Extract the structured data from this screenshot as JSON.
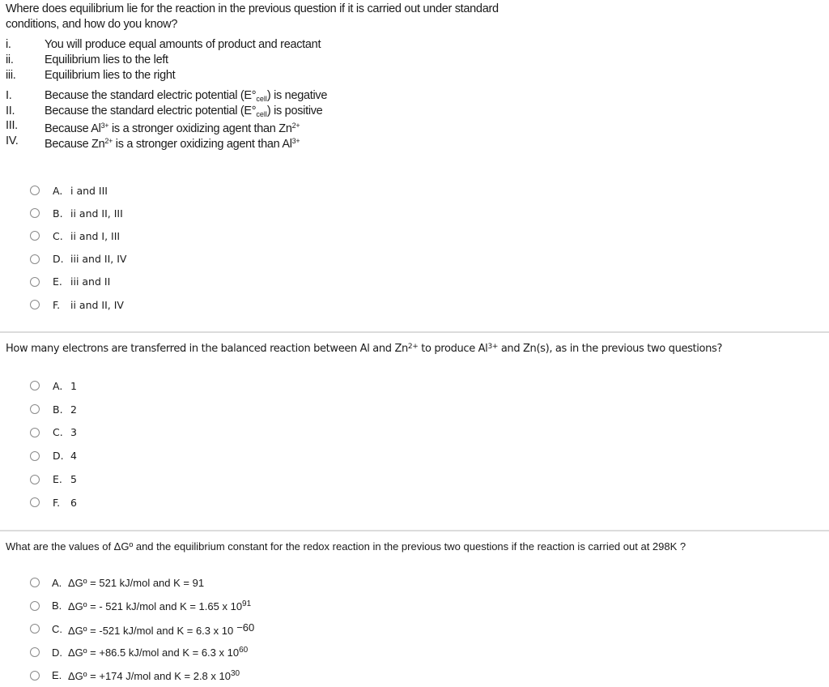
{
  "question1": {
    "title": "Where does equilibrium lie for the reaction in the previous question if it is carried out under standard conditions, and how do you know?",
    "statements_lower": [
      {
        "num": "i.",
        "text": "You will produce equal amounts of product and reactant"
      },
      {
        "num": "ii.",
        "text": "Equilibrium lies to the left"
      },
      {
        "num": "iii.",
        "text": "Equilibrium lies to the right"
      }
    ],
    "statements_upper": [
      {
        "num": "I.",
        "pre": "Because the standard electric potential (E°",
        "sub": "cell",
        "post": ") is negative"
      },
      {
        "num": "II.",
        "pre": "Because the standard electric potential (E°",
        "sub": "cell",
        "post": ") is positive"
      },
      {
        "num": "III.",
        "a": "Because Al",
        "a_sup": "3+",
        "b": " is a stronger oxidizing agent than Zn",
        "b_sup": "2+"
      },
      {
        "num": "IV.",
        "a": "Because Zn",
        "a_sup": "2+",
        "b": " is a stronger oxidizing agent than Al",
        "b_sup": "3+"
      }
    ],
    "options": [
      {
        "letter": "A.",
        "text": "i and III"
      },
      {
        "letter": "B.",
        "text": "ii and II, III"
      },
      {
        "letter": "C.",
        "text": "ii and I, III"
      },
      {
        "letter": "D.",
        "text": "iii and II, IV"
      },
      {
        "letter": "E.",
        "text": "iii and II"
      },
      {
        "letter": "F.",
        "text": "ii and II, IV"
      }
    ]
  },
  "question2": {
    "p1": "How many electrons are transferred in the balanced reaction between Al and Zn",
    "s1": "2+",
    "p2": " to produce Al",
    "s2": "3+",
    "p3": " and Zn(s), as in the previous two questions?",
    "options": [
      {
        "letter": "A.",
        "text": "1"
      },
      {
        "letter": "B.",
        "text": "2"
      },
      {
        "letter": "C.",
        "text": "3"
      },
      {
        "letter": "D.",
        "text": "4"
      },
      {
        "letter": "E.",
        "text": "5"
      },
      {
        "letter": "F.",
        "text": "6"
      }
    ]
  },
  "question3": {
    "text": "What are the values of  ΔGº and the equilibrium constant for the redox reaction in the previous two questions if the reaction is carried out at 298K ?",
    "options": [
      {
        "letter": "A.",
        "text": "ΔGº = 521 kJ/mol and K = 91",
        "exp": ""
      },
      {
        "letter": "B.",
        "text": "ΔGº = - 521 kJ/mol and K = 1.65 x 10",
        "exp": "91"
      },
      {
        "letter": "C.",
        "text": "ΔGº = -521 kJ/mol and K = 6.3 x 10",
        "exp_neg": "−60"
      },
      {
        "letter": "D.",
        "text": "ΔGº = +86.5 kJ/mol and K = 6.3 x 10",
        "exp": "60"
      },
      {
        "letter": "E.",
        "text": "ΔGº = +174 J/mol and K = 2.8 x 10",
        "exp": "30"
      }
    ]
  }
}
